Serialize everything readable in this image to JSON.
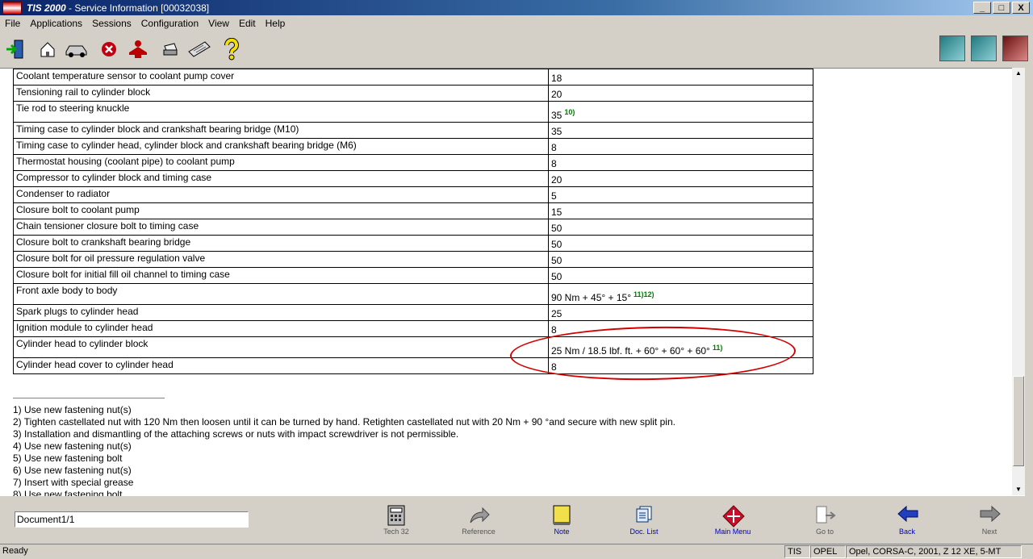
{
  "window": {
    "logo_text": "TIS 2000",
    "title_rest": " - Service Information [00032038]",
    "minimize": "_",
    "maximize": "□",
    "close": "X"
  },
  "menu": [
    "File",
    "Applications",
    "Sessions",
    "Configuration",
    "View",
    "Edit",
    "Help"
  ],
  "table": {
    "rows": [
      {
        "part": "Coolant temperature sensor to coolant pump cover",
        "value": "18",
        "note": ""
      },
      {
        "part": "Tensioning rail to cylinder block",
        "value": "20",
        "note": ""
      },
      {
        "part": "Tie rod to steering knuckle",
        "value": "35",
        "note": "10)"
      },
      {
        "part": "Timing case to cylinder block and crankshaft bearing bridge (M10)",
        "value": "35",
        "note": ""
      },
      {
        "part": "Timing case to cylinder head, cylinder block and crankshaft bearing bridge (M6)",
        "value": "8",
        "note": ""
      },
      {
        "part": "Thermostat housing (coolant pipe) to coolant pump",
        "value": "8",
        "note": ""
      },
      {
        "part": "Compressor to cylinder block and timing case",
        "value": "20",
        "note": ""
      },
      {
        "part": "Condenser to radiator",
        "value": "5",
        "note": ""
      },
      {
        "part": "Closure bolt to coolant pump",
        "value": "15",
        "note": ""
      },
      {
        "part": "Chain tensioner closure bolt to timing case",
        "value": "50",
        "note": ""
      },
      {
        "part": "Closure bolt to crankshaft bearing bridge",
        "value": "50",
        "note": ""
      },
      {
        "part": "Closure bolt for oil pressure regulation valve",
        "value": "50",
        "note": ""
      },
      {
        "part": "Closure bolt for initial fill oil channel to timing case",
        "value": "50",
        "note": ""
      },
      {
        "part": "Front axle body to body",
        "value": "90 Nm + 45° + 15°",
        "note": "11)12)"
      },
      {
        "part": "Spark plugs to cylinder head",
        "value": "25",
        "note": ""
      },
      {
        "part": "Ignition module to cylinder head",
        "value": "8",
        "note": ""
      },
      {
        "part": "Cylinder head to cylinder block",
        "value": "25 Nm / 18.5 lbf. ft. + 60° + 60° + 60°",
        "note": "11)"
      },
      {
        "part": "Cylinder head cover to cylinder head",
        "value": "8",
        "note": ""
      }
    ]
  },
  "footnotes": [
    "1) Use new fastening nut(s)",
    "2) Tighten castellated nut with 120 Nm then loosen until it can be turned by hand. Retighten castellated nut with 20 Nm + 90 °and secure with new split pin.",
    "3) Installation and dismantling of the attaching screws or nuts with impact screwdriver is not permissible.",
    "4) Use new fastening nut(s)",
    "5) Use new fastening bolt",
    "6) Use new fastening nut(s)",
    "7) Insert with special grease",
    "8) Use new fastening bolt"
  ],
  "bottom": {
    "document_field": "Document1/1",
    "nav": [
      {
        "label": "Tech 32",
        "icon": "calculator-icon"
      },
      {
        "label": "Reference",
        "icon": "reference-arrow-icon"
      },
      {
        "label": "Note",
        "icon": "note-icon"
      },
      {
        "label": "Doc. List",
        "icon": "doc-list-icon"
      },
      {
        "label": "Main Menu",
        "icon": "main-menu-icon"
      },
      {
        "label": "Go to",
        "icon": "go-to-icon"
      },
      {
        "label": "Back",
        "icon": "back-arrow-icon"
      },
      {
        "label": "Next",
        "icon": "next-arrow-icon"
      }
    ]
  },
  "status": {
    "ready": "Ready",
    "app": "TIS",
    "brand": "OPEL",
    "vehicle": "Opel, CORSA-C, 2001, Z 12 XE, 5-MT"
  },
  "colors": {
    "highlight_ellipse": "#d40000",
    "footnote_ref": "#007a00"
  }
}
